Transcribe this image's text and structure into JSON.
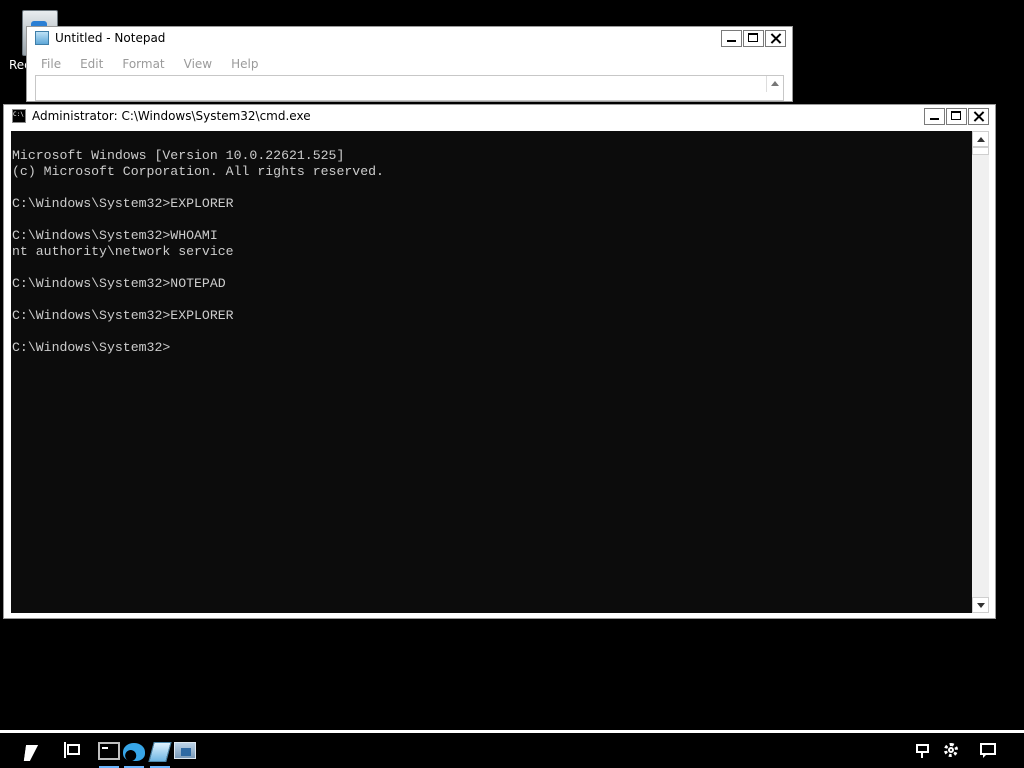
{
  "desktop": {
    "recycle_bin_label": "Rec"
  },
  "notepad": {
    "title": "Untitled - Notepad",
    "menu": [
      "File",
      "Edit",
      "Format",
      "View",
      "Help"
    ]
  },
  "cmd": {
    "title": "Administrator: C:\\Windows\\System32\\cmd.exe",
    "lines": [
      "Microsoft Windows [Version 10.0.22621.525]",
      "(c) Microsoft Corporation. All rights reserved.",
      "",
      "C:\\Windows\\System32>EXPLORER",
      "",
      "C:\\Windows\\System32>WHOAMI",
      "nt authority\\network service",
      "",
      "C:\\Windows\\System32>NOTEPAD",
      "",
      "C:\\Windows\\System32>EXPLORER",
      "",
      "C:\\Windows\\System32>"
    ]
  },
  "taskbar": {
    "pinned": [
      "command-prompt-icon",
      "edge-icon",
      "notepad-icon",
      "remote-desktop-icon"
    ],
    "tray": [
      "network-icon",
      "settings-gear-icon",
      "notification-icon"
    ],
    "accent_color": "#6cb6ff"
  }
}
